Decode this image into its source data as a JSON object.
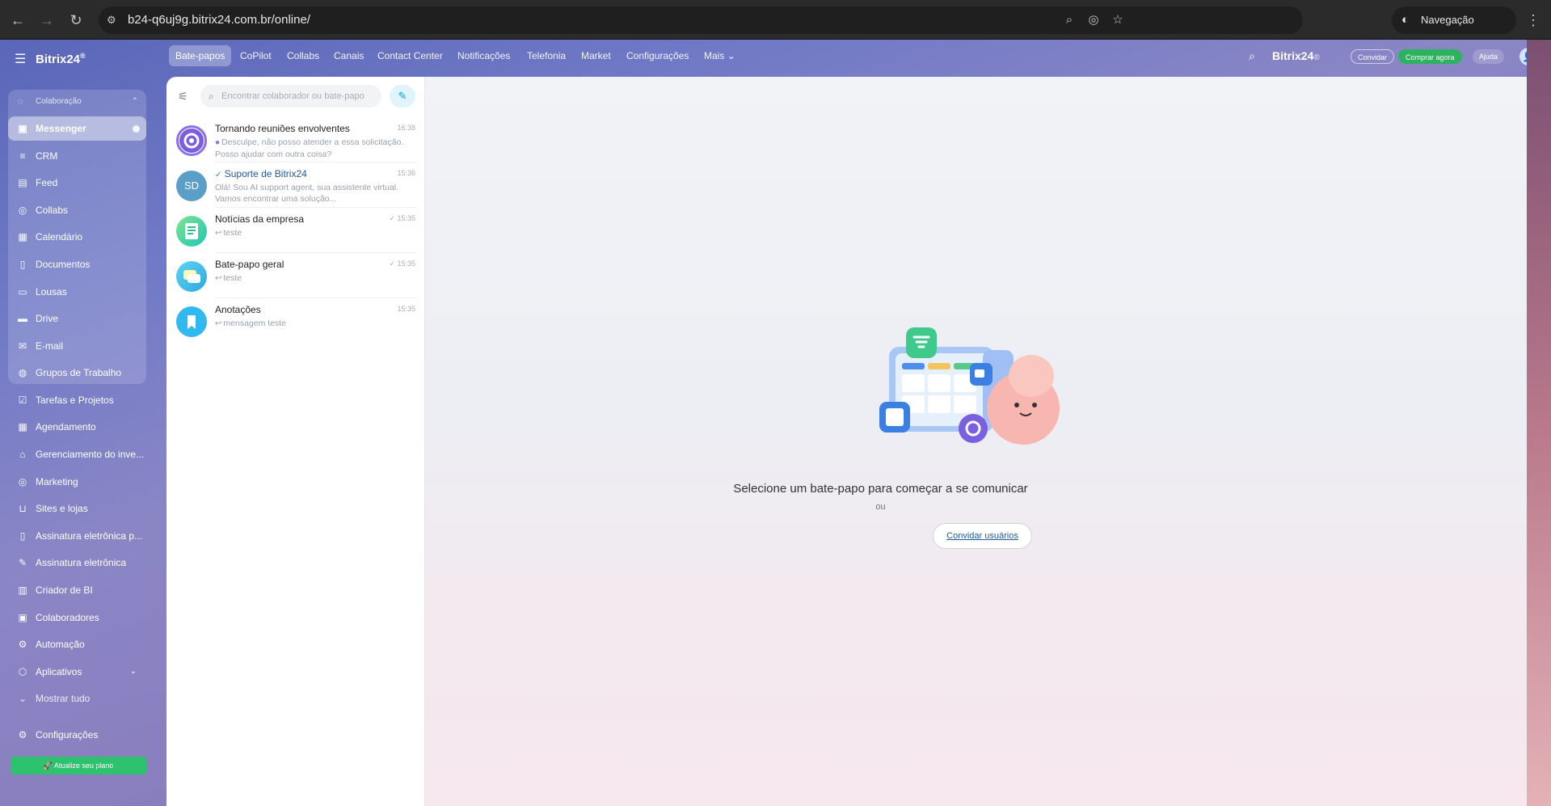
{
  "browser": {
    "url": "b24-q6uj9g.bitrix24.com.br/online/",
    "incognito_label": "Navegação anônima"
  },
  "sidebar": {
    "logo": "Bitrix24",
    "logo_suffix": "®",
    "group_title": "Colaboração",
    "items": [
      {
        "label": "Messenger",
        "icon": "messenger-icon"
      },
      {
        "label": "CRM",
        "icon": "crm-icon"
      },
      {
        "label": "Feed",
        "icon": "feed-icon"
      },
      {
        "label": "Collabs",
        "icon": "collabs-icon"
      },
      {
        "label": "Calendário",
        "icon": "calendar-icon"
      },
      {
        "label": "Documentos",
        "icon": "documents-icon"
      },
      {
        "label": "Lousas",
        "icon": "boards-icon"
      },
      {
        "label": "Drive",
        "icon": "drive-icon"
      },
      {
        "label": "E-mail",
        "icon": "email-icon"
      },
      {
        "label": "Grupos de Trabalho",
        "icon": "workgroups-icon"
      },
      {
        "label": "Tarefas e Projetos",
        "icon": "tasks-icon"
      },
      {
        "label": "Agendamento",
        "icon": "booking-icon"
      },
      {
        "label": "Gerenciamento do inve...",
        "icon": "inventory-icon"
      },
      {
        "label": "Marketing",
        "icon": "marketing-icon"
      },
      {
        "label": "Sites e lojas",
        "icon": "shop-icon"
      },
      {
        "label": "Assinatura eletrônica p...",
        "icon": "sign-icon"
      },
      {
        "label": "Assinatura eletrônica",
        "icon": "sign2-icon"
      },
      {
        "label": "Criador de BI",
        "icon": "bi-icon"
      },
      {
        "label": "Colaboradores",
        "icon": "employees-icon"
      },
      {
        "label": "Automação",
        "icon": "automation-icon"
      },
      {
        "label": "Aplicativos",
        "icon": "apps-icon"
      },
      {
        "label": "Mostrar tudo",
        "icon": "chevron-down-icon"
      },
      {
        "label": "Configurações",
        "icon": "gear-icon"
      }
    ],
    "upgrade_label": "Atualize seu plano"
  },
  "topnav": {
    "items": [
      "Bate-papos",
      "CoPilot",
      "Collabs",
      "Canais",
      "Contact Center",
      "Notificações",
      "Telefonia",
      "Market",
      "Configurações",
      "Mais"
    ],
    "brand": "Bitrix24",
    "brand_suffix": "®",
    "invite": "Convidar",
    "buy": "Comprar agora",
    "help": "Ajuda"
  },
  "chatlist": {
    "search_placeholder": "Encontrar colaborador ou bate-papo",
    "chats": [
      {
        "title": "Tornando reuniões envolventes",
        "time": "16:38",
        "preview": "Desculpe, não posso atender a essa solicitação. Posso ajudar com outra coisa?"
      },
      {
        "title": "Suporte de Bitrix24",
        "time": "15:36",
        "preview": "Olá! Sou AI support agent, sua assistente virtual. Vamos encontrar uma solução...",
        "initials": "SD"
      },
      {
        "title": "Notícias da empresa",
        "time": "15:35",
        "preview": "teste"
      },
      {
        "title": "Bate-papo geral",
        "time": "15:35",
        "preview": "teste"
      },
      {
        "title": "Anotações",
        "time": "15:35",
        "preview": "mensagem teste"
      }
    ]
  },
  "main": {
    "select_message": "Selecione um bate-papo para começar a se comunicar",
    "or": "ou",
    "invite_users": "Convidar usuários"
  }
}
